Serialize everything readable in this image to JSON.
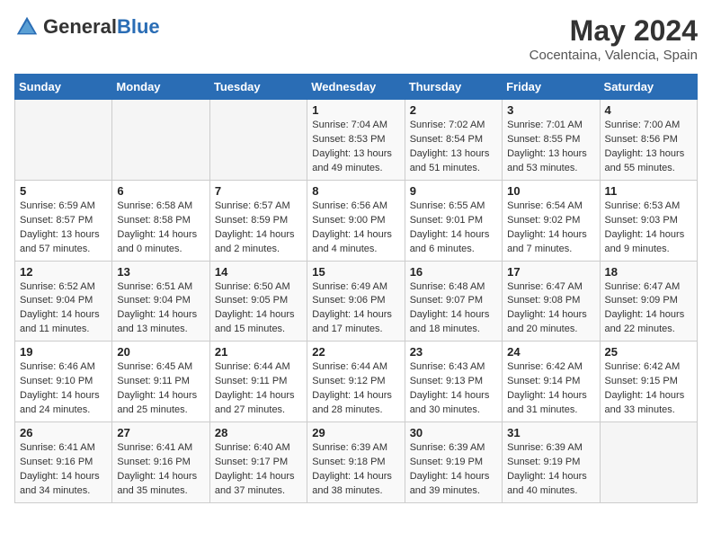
{
  "header": {
    "logo_general": "General",
    "logo_blue": "Blue",
    "title": "May 2024",
    "subtitle": "Cocentaina, Valencia, Spain"
  },
  "calendar": {
    "days_of_week": [
      "Sunday",
      "Monday",
      "Tuesday",
      "Wednesday",
      "Thursday",
      "Friday",
      "Saturday"
    ],
    "weeks": [
      [
        {
          "day": "",
          "sunrise": "",
          "sunset": "",
          "daylight": ""
        },
        {
          "day": "",
          "sunrise": "",
          "sunset": "",
          "daylight": ""
        },
        {
          "day": "",
          "sunrise": "",
          "sunset": "",
          "daylight": ""
        },
        {
          "day": "1",
          "sunrise": "Sunrise: 7:04 AM",
          "sunset": "Sunset: 8:53 PM",
          "daylight": "Daylight: 13 hours and 49 minutes."
        },
        {
          "day": "2",
          "sunrise": "Sunrise: 7:02 AM",
          "sunset": "Sunset: 8:54 PM",
          "daylight": "Daylight: 13 hours and 51 minutes."
        },
        {
          "day": "3",
          "sunrise": "Sunrise: 7:01 AM",
          "sunset": "Sunset: 8:55 PM",
          "daylight": "Daylight: 13 hours and 53 minutes."
        },
        {
          "day": "4",
          "sunrise": "Sunrise: 7:00 AM",
          "sunset": "Sunset: 8:56 PM",
          "daylight": "Daylight: 13 hours and 55 minutes."
        }
      ],
      [
        {
          "day": "5",
          "sunrise": "Sunrise: 6:59 AM",
          "sunset": "Sunset: 8:57 PM",
          "daylight": "Daylight: 13 hours and 57 minutes."
        },
        {
          "day": "6",
          "sunrise": "Sunrise: 6:58 AM",
          "sunset": "Sunset: 8:58 PM",
          "daylight": "Daylight: 14 hours and 0 minutes."
        },
        {
          "day": "7",
          "sunrise": "Sunrise: 6:57 AM",
          "sunset": "Sunset: 8:59 PM",
          "daylight": "Daylight: 14 hours and 2 minutes."
        },
        {
          "day": "8",
          "sunrise": "Sunrise: 6:56 AM",
          "sunset": "Sunset: 9:00 PM",
          "daylight": "Daylight: 14 hours and 4 minutes."
        },
        {
          "day": "9",
          "sunrise": "Sunrise: 6:55 AM",
          "sunset": "Sunset: 9:01 PM",
          "daylight": "Daylight: 14 hours and 6 minutes."
        },
        {
          "day": "10",
          "sunrise": "Sunrise: 6:54 AM",
          "sunset": "Sunset: 9:02 PM",
          "daylight": "Daylight: 14 hours and 7 minutes."
        },
        {
          "day": "11",
          "sunrise": "Sunrise: 6:53 AM",
          "sunset": "Sunset: 9:03 PM",
          "daylight": "Daylight: 14 hours and 9 minutes."
        }
      ],
      [
        {
          "day": "12",
          "sunrise": "Sunrise: 6:52 AM",
          "sunset": "Sunset: 9:04 PM",
          "daylight": "Daylight: 14 hours and 11 minutes."
        },
        {
          "day": "13",
          "sunrise": "Sunrise: 6:51 AM",
          "sunset": "Sunset: 9:04 PM",
          "daylight": "Daylight: 14 hours and 13 minutes."
        },
        {
          "day": "14",
          "sunrise": "Sunrise: 6:50 AM",
          "sunset": "Sunset: 9:05 PM",
          "daylight": "Daylight: 14 hours and 15 minutes."
        },
        {
          "day": "15",
          "sunrise": "Sunrise: 6:49 AM",
          "sunset": "Sunset: 9:06 PM",
          "daylight": "Daylight: 14 hours and 17 minutes."
        },
        {
          "day": "16",
          "sunrise": "Sunrise: 6:48 AM",
          "sunset": "Sunset: 9:07 PM",
          "daylight": "Daylight: 14 hours and 18 minutes."
        },
        {
          "day": "17",
          "sunrise": "Sunrise: 6:47 AM",
          "sunset": "Sunset: 9:08 PM",
          "daylight": "Daylight: 14 hours and 20 minutes."
        },
        {
          "day": "18",
          "sunrise": "Sunrise: 6:47 AM",
          "sunset": "Sunset: 9:09 PM",
          "daylight": "Daylight: 14 hours and 22 minutes."
        }
      ],
      [
        {
          "day": "19",
          "sunrise": "Sunrise: 6:46 AM",
          "sunset": "Sunset: 9:10 PM",
          "daylight": "Daylight: 14 hours and 24 minutes."
        },
        {
          "day": "20",
          "sunrise": "Sunrise: 6:45 AM",
          "sunset": "Sunset: 9:11 PM",
          "daylight": "Daylight: 14 hours and 25 minutes."
        },
        {
          "day": "21",
          "sunrise": "Sunrise: 6:44 AM",
          "sunset": "Sunset: 9:11 PM",
          "daylight": "Daylight: 14 hours and 27 minutes."
        },
        {
          "day": "22",
          "sunrise": "Sunrise: 6:44 AM",
          "sunset": "Sunset: 9:12 PM",
          "daylight": "Daylight: 14 hours and 28 minutes."
        },
        {
          "day": "23",
          "sunrise": "Sunrise: 6:43 AM",
          "sunset": "Sunset: 9:13 PM",
          "daylight": "Daylight: 14 hours and 30 minutes."
        },
        {
          "day": "24",
          "sunrise": "Sunrise: 6:42 AM",
          "sunset": "Sunset: 9:14 PM",
          "daylight": "Daylight: 14 hours and 31 minutes."
        },
        {
          "day": "25",
          "sunrise": "Sunrise: 6:42 AM",
          "sunset": "Sunset: 9:15 PM",
          "daylight": "Daylight: 14 hours and 33 minutes."
        }
      ],
      [
        {
          "day": "26",
          "sunrise": "Sunrise: 6:41 AM",
          "sunset": "Sunset: 9:16 PM",
          "daylight": "Daylight: 14 hours and 34 minutes."
        },
        {
          "day": "27",
          "sunrise": "Sunrise: 6:41 AM",
          "sunset": "Sunset: 9:16 PM",
          "daylight": "Daylight: 14 hours and 35 minutes."
        },
        {
          "day": "28",
          "sunrise": "Sunrise: 6:40 AM",
          "sunset": "Sunset: 9:17 PM",
          "daylight": "Daylight: 14 hours and 37 minutes."
        },
        {
          "day": "29",
          "sunrise": "Sunrise: 6:39 AM",
          "sunset": "Sunset: 9:18 PM",
          "daylight": "Daylight: 14 hours and 38 minutes."
        },
        {
          "day": "30",
          "sunrise": "Sunrise: 6:39 AM",
          "sunset": "Sunset: 9:19 PM",
          "daylight": "Daylight: 14 hours and 39 minutes."
        },
        {
          "day": "31",
          "sunrise": "Sunrise: 6:39 AM",
          "sunset": "Sunset: 9:19 PM",
          "daylight": "Daylight: 14 hours and 40 minutes."
        },
        {
          "day": "",
          "sunrise": "",
          "sunset": "",
          "daylight": ""
        }
      ]
    ]
  }
}
